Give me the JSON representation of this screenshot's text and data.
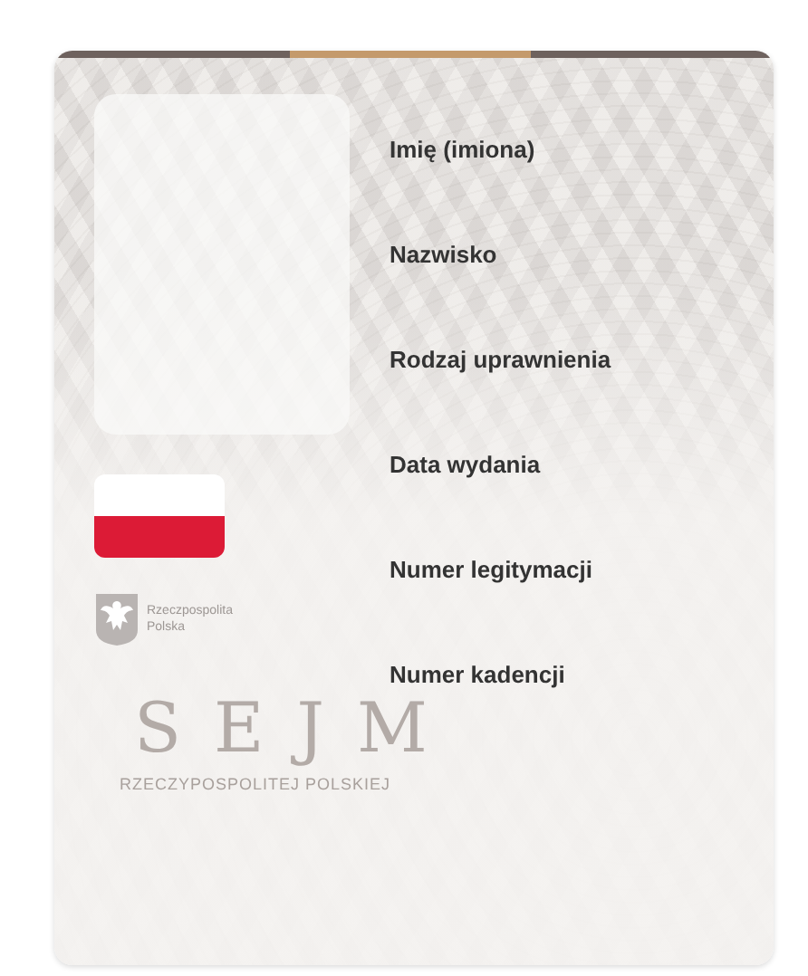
{
  "card": {
    "fields": [
      {
        "label": "Imię (imiona)"
      },
      {
        "label": "Nazwisko"
      },
      {
        "label": "Rodzaj uprawnienia"
      },
      {
        "label": "Data wydania"
      },
      {
        "label": "Numer legitymacji"
      },
      {
        "label": "Numer kadencji"
      }
    ],
    "emblem_text": [
      "Rzeczpospolita",
      "Polska"
    ],
    "watermark": {
      "title": "SEJM",
      "subtitle": "RZECZYPOSPOLITEJ POLSKIEJ"
    }
  }
}
